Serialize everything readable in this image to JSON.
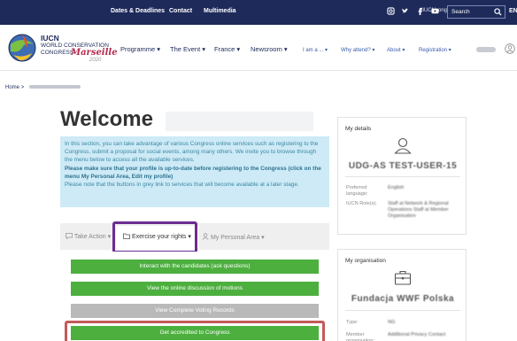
{
  "topbar": {
    "links": [
      "Dates & Deadlines",
      "Contact",
      "Multimedia"
    ],
    "hashtag": "#IUCNcongress",
    "social_icons": [
      "instagram-icon",
      "twitter-icon",
      "facebook-icon",
      "youtube-icon"
    ],
    "search_placeholder": "Search",
    "language": "EN"
  },
  "logo": {
    "line1": "IUCN",
    "line2": "WORLD CONSERVATION",
    "line3": "CONGRESS",
    "city": "Marseille",
    "year": "2020"
  },
  "nav": {
    "main": [
      "Programme ▾",
      "The Event ▾",
      "France ▾",
      "Newsroom ▾"
    ],
    "secondary": [
      "I am a ... ▾",
      "Why attend? ▾",
      "About ▾",
      "Registration ▾"
    ]
  },
  "breadcrumb": {
    "home": "Home",
    "sep": ">"
  },
  "main": {
    "title": "Welcome",
    "info_plain_1": "In this section, you can take advantage of various Congress online services such as registering to the Congress, submit a proposal for social events, among many others. We invite you to browse through the menu below to access all the available services.",
    "info_bold": "Please make sure that your profile is up-to-date before registering to the Congress (click on the menu My Personal Area, Edit my profile)",
    "info_plain_2": "Please note that the buttons in grey link to services that will become available at a later stage.",
    "tabs": [
      "Take Action ▾",
      "Exercise your rights ▾",
      "My Personal Area ▾"
    ],
    "buttons": [
      {
        "label": "Interact with the candidates (ask questions)",
        "state": "enabled"
      },
      {
        "label": "View the online discussion of motions",
        "state": "enabled"
      },
      {
        "label": "View Complete Voting Records",
        "state": "disabled"
      },
      {
        "label": "Get accredited to Congress",
        "state": "enabled"
      }
    ]
  },
  "sidebar": {
    "details": {
      "title": "My details",
      "name": "UDG-AS TEST-USER-15",
      "rows": [
        {
          "label": "Preferred language:",
          "value": "English"
        },
        {
          "label": "IUCN Role(s):",
          "value": "Staff at Network & Regional Operations Staff at Member Organisation"
        }
      ]
    },
    "organisation": {
      "title": "My organisation",
      "name": "Fundacja WWF Polska",
      "rows": [
        {
          "label": "Type:",
          "value": "NG"
        },
        {
          "label": "Member organisation:",
          "value": "Additional Privacy Contact"
        }
      ]
    }
  },
  "colors": {
    "topbar": "#1d2a5a",
    "accent_green": "#4caf3e",
    "info_bg": "#cdeaf6",
    "highlight_purple": "#6a2d8f",
    "highlight_red": "#c45a5a"
  }
}
